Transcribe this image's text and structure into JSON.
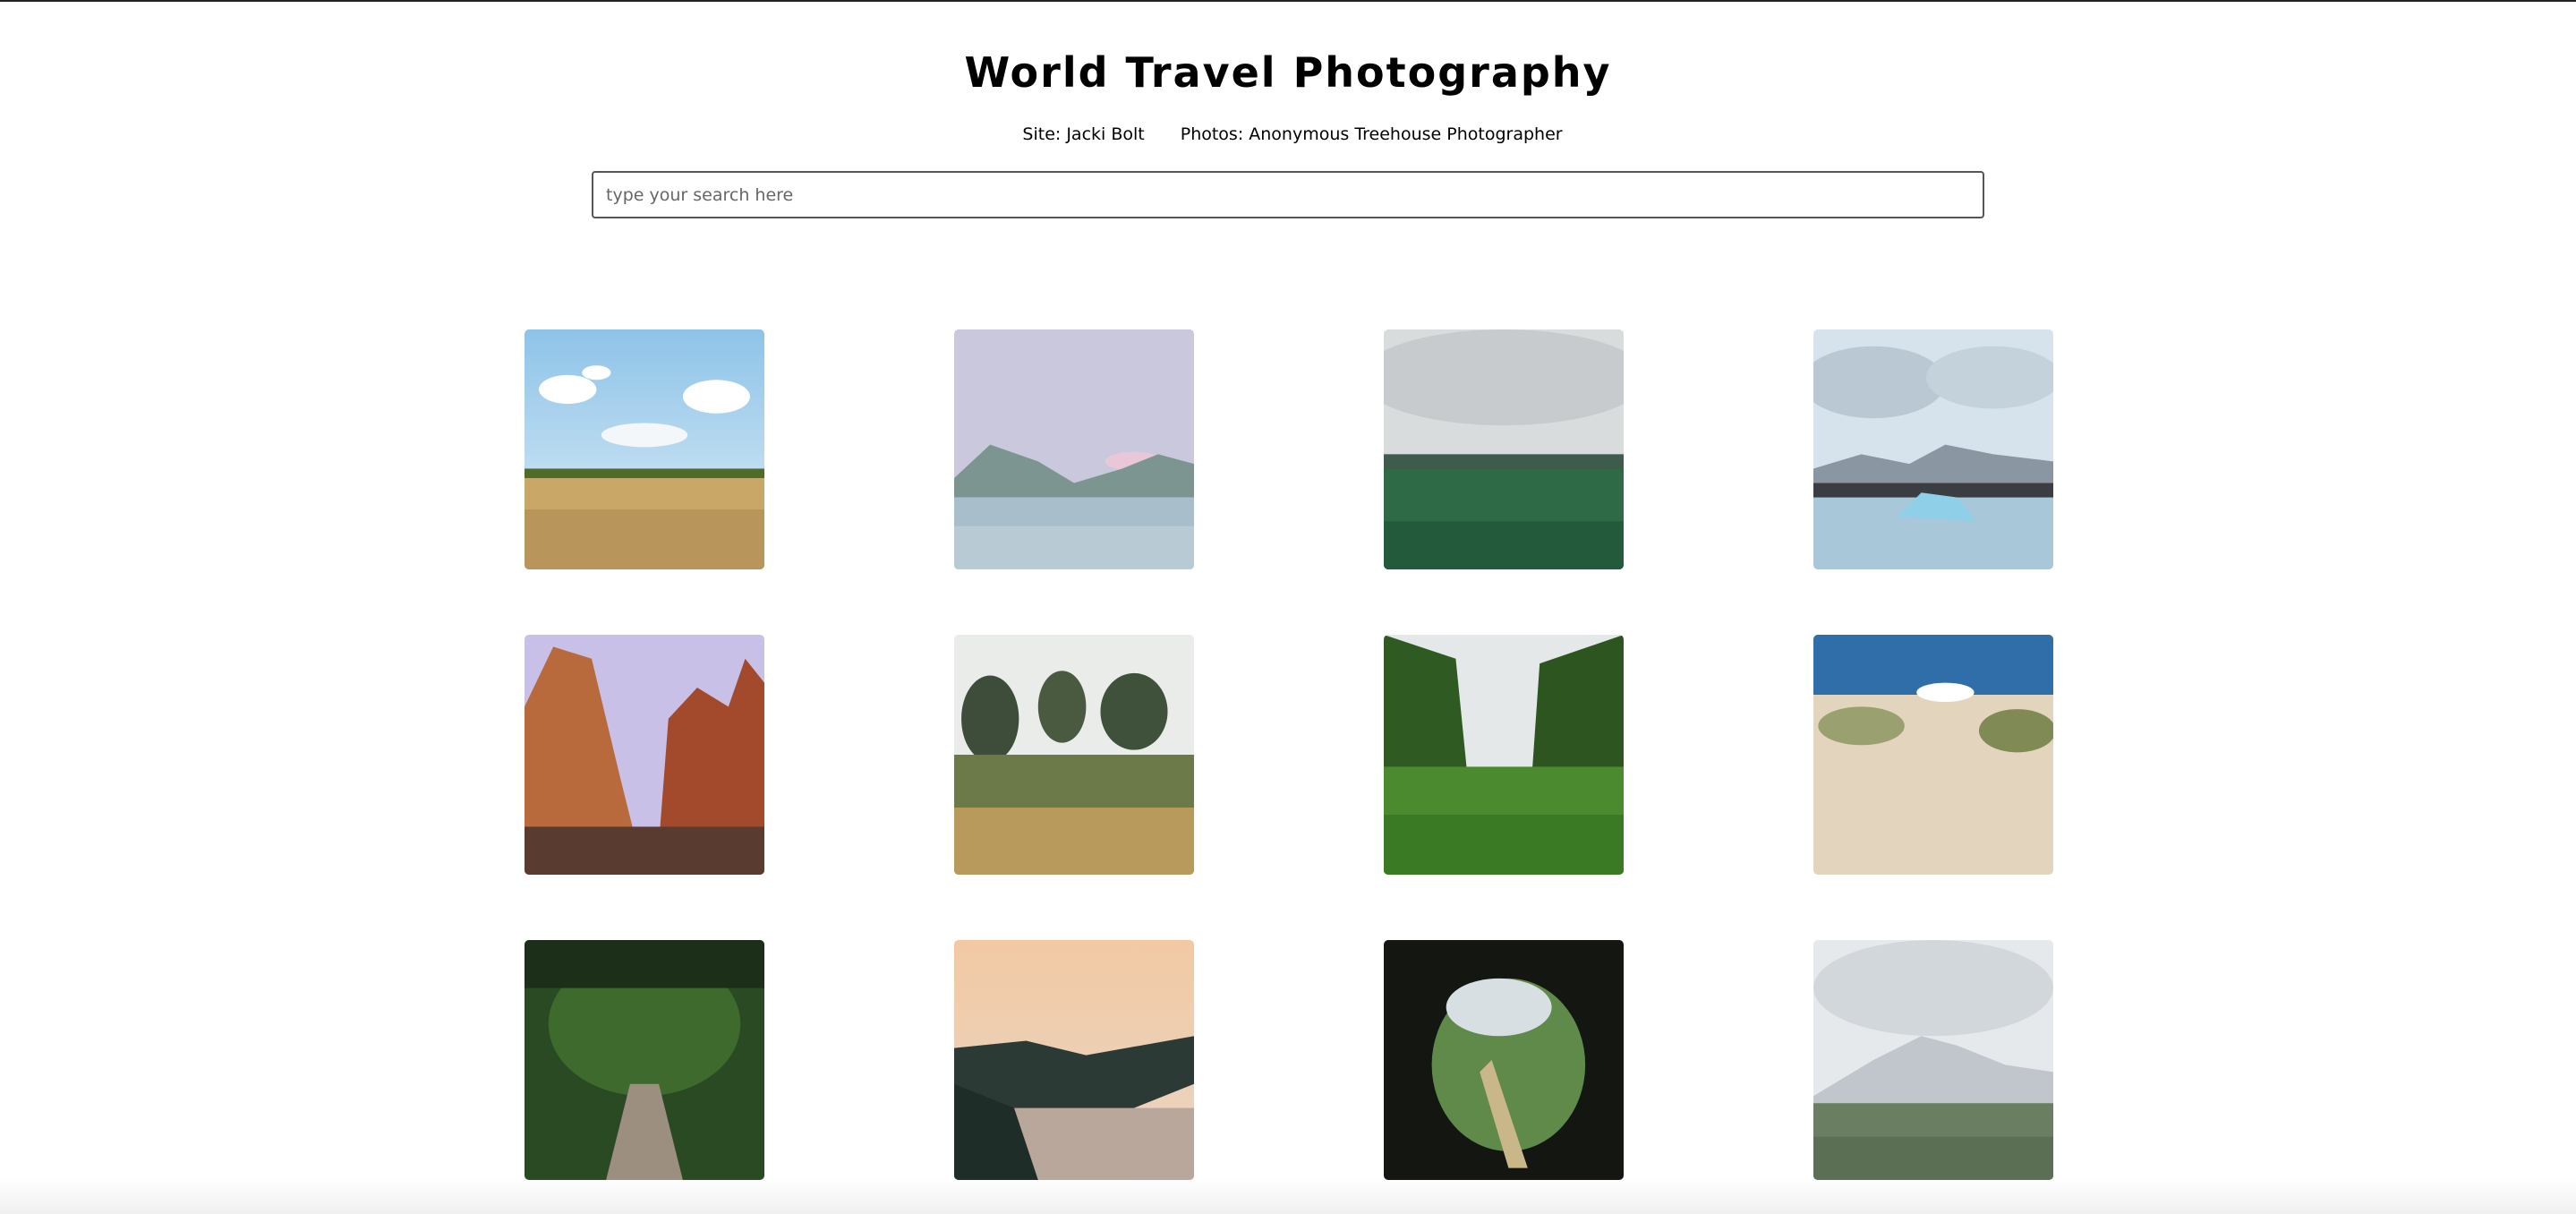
{
  "header": {
    "title": "World Travel Photography",
    "site_credit": "Site: Jacki Bolt",
    "photo_credit": "Photos: Anonymous Treehouse Photographer"
  },
  "search": {
    "placeholder": "type your search here",
    "value": ""
  },
  "gallery": {
    "photos": [
      {
        "subject": "wheat field with blue sky and clouds"
      },
      {
        "subject": "calm lake with mountains at dusk"
      },
      {
        "subject": "green meadow under cloudy sky"
      },
      {
        "subject": "icebergs on lagoon with snowy mountains"
      },
      {
        "subject": "red rock canyon cliffs"
      },
      {
        "subject": "wild garden with trees and grasses"
      },
      {
        "subject": "green valley through forest opening"
      },
      {
        "subject": "sand dunes with grass and blue sky"
      },
      {
        "subject": "forest path under tree canopy"
      },
      {
        "subject": "coastal cliffs at sunset"
      },
      {
        "subject": "cave opening overlooking green valley"
      },
      {
        "subject": "snowy mountain above wildflower field"
      }
    ]
  }
}
